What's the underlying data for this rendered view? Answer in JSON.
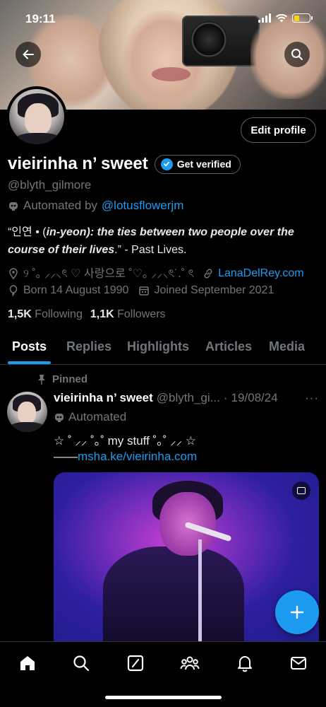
{
  "status_bar": {
    "time": "19:11"
  },
  "profile": {
    "display_name": "vieirinha n’ sweet",
    "get_verified_label": "Get verified",
    "edit_profile_label": "Edit profile",
    "handle": "@blyth_gilmore",
    "automated_by_label": "Automated by",
    "automated_by_link": "@lotusflowerjm",
    "bio_quote_open": "“인연 • (",
    "bio_term": "in-yeon",
    "bio_rest": "): the ties between two people over the course of their lives",
    "bio_quote_close": ".” - Past Lives.",
    "location": "୨ ˚｡ ⸝⸝⸜ৎ ♡ 사랑으로 ˚♡｡ ⸝⸝⸜ৎ˙.˚ ৎ",
    "website": "LanaDelRey.com",
    "born": "Born 14 August 1990",
    "joined": "Joined September 2021",
    "following_count": "1,5K",
    "following_label": "Following",
    "followers_count": "1,1K",
    "followers_label": "Followers"
  },
  "tabs": [
    {
      "label": "Posts",
      "active": true
    },
    {
      "label": "Replies"
    },
    {
      "label": "Highlights"
    },
    {
      "label": "Articles"
    },
    {
      "label": "Media"
    }
  ],
  "post": {
    "pinned_label": "Pinned",
    "author_name": "vieirinha n’ sweet",
    "author_handle": "@blyth_gi...",
    "dot": "·",
    "date": "19/08/24",
    "more": "···",
    "automated_label": "Automated",
    "text_line1": "☆ ˚ ⸝⸝ ˚｡˚ my stuff  ˚｡˚ ⸝⸝ ☆",
    "text_dash": "——",
    "text_link": "msha.ke/vieirinha.com"
  },
  "colors": {
    "accent": "#1d9bf0",
    "background": "#000000",
    "secondary_text": "#71767b"
  },
  "icons": {
    "back": "arrow-left-icon",
    "search": "search-icon",
    "verified": "verified-badge-icon",
    "automated": "robot-icon",
    "location": "location-pin-icon",
    "link": "link-icon",
    "born": "balloon-icon",
    "joined": "calendar-icon",
    "pin": "pin-icon",
    "compose": "plus-icon",
    "nav": [
      "home-icon",
      "search-icon",
      "grok-icon",
      "communities-icon",
      "bell-icon",
      "mail-icon"
    ]
  }
}
